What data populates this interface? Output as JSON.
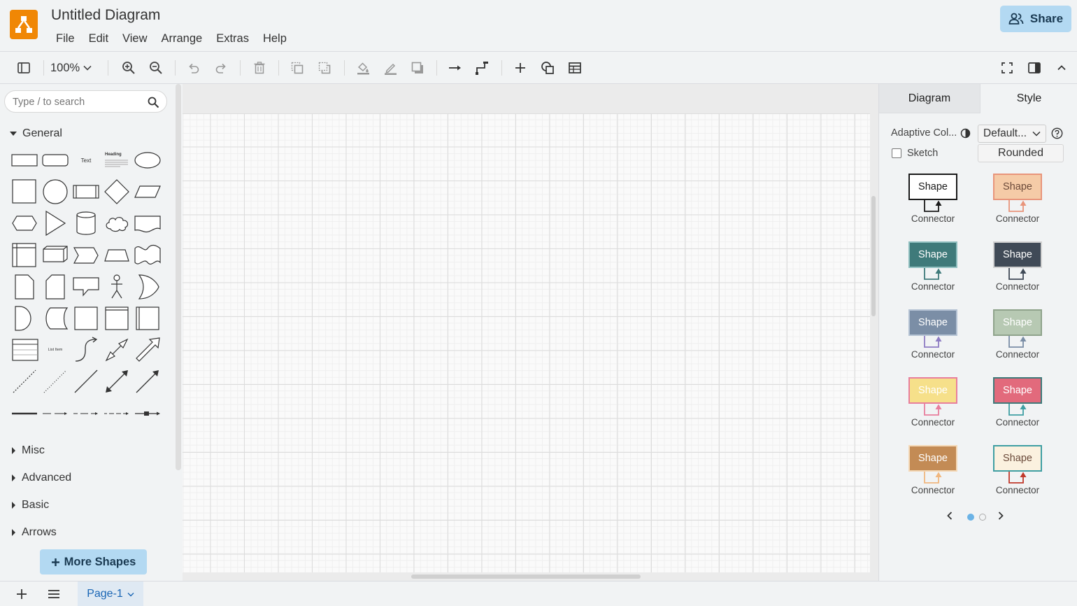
{
  "app": {
    "title": "Untitled Diagram",
    "menu": [
      "File",
      "Edit",
      "View",
      "Arrange",
      "Extras",
      "Help"
    ],
    "share_label": "Share",
    "accent_color": "#f08705"
  },
  "toolbar": {
    "zoom_level": "100%",
    "buttons": [
      "format-panel-toggle",
      "zoom-in",
      "zoom-out",
      "undo",
      "redo",
      "delete",
      "to-front",
      "to-back",
      "fill-color",
      "line-color",
      "shadow",
      "connection",
      "waypoints",
      "insert",
      "shapes",
      "table",
      "fullscreen",
      "format-panel",
      "collapse"
    ]
  },
  "left_panel": {
    "search_placeholder": "Type / to search",
    "general_label": "General",
    "shape_text_label": "Text",
    "shape_heading_label": "Heading",
    "shape_list_item_label": "List Item",
    "sections": [
      "Misc",
      "Advanced",
      "Basic",
      "Arrows"
    ],
    "more_shapes_label": "More Shapes"
  },
  "right_panel": {
    "tabs": [
      "Diagram",
      "Style"
    ],
    "active_tab": "Style",
    "adaptive_colors_label": "Adaptive Col...",
    "adaptive_colors_value": "Default...",
    "sketch_label": "Sketch",
    "sketch_checked": false,
    "rounded_label": "Rounded",
    "styles": [
      {
        "shape": "Shape",
        "connector": "Connector",
        "fill": "#ffffff",
        "stroke": "#1a1a1a",
        "text": "#1a1a1a",
        "line": "#1a1a1a"
      },
      {
        "shape": "Shape",
        "connector": "Connector",
        "fill": "#f5cba7",
        "stroke": "#e8957b",
        "text": "#6b4a3a",
        "line": "#e8957b"
      },
      {
        "shape": "Shape",
        "connector": "Connector",
        "fill": "#3f7a7a",
        "stroke": "#8fbfbf",
        "text": "#ffffff",
        "line": "#3f7a7a"
      },
      {
        "shape": "Shape",
        "connector": "Connector",
        "fill": "#404a57",
        "stroke": "#cfcfcf",
        "text": "#ffffff",
        "line": "#404a57"
      },
      {
        "shape": "Shape",
        "connector": "Connector",
        "fill": "#7b8ea6",
        "stroke": "#b5c3d4",
        "text": "#ffffff",
        "line": "#8e7cc3"
      },
      {
        "shape": "Shape",
        "connector": "Connector",
        "fill": "#b7c9b3",
        "stroke": "#8fa38b",
        "text": "#ffffff",
        "line": "#7b8ea6"
      },
      {
        "shape": "Shape",
        "connector": "Connector",
        "fill": "#f6e08a",
        "stroke": "#e87e9d",
        "text": "#ffffff",
        "line": "#e87e9d"
      },
      {
        "shape": "Shape",
        "connector": "Connector",
        "fill": "#e26a7c",
        "stroke": "#3f7a7a",
        "text": "#ffffff",
        "line": "#3f9fa3"
      },
      {
        "shape": "Shape",
        "connector": "Connector",
        "fill": "#c38b55",
        "stroke": "#f4d9b8",
        "text": "#ffffff",
        "line": "#f0b77f"
      },
      {
        "shape": "Shape",
        "connector": "Connector",
        "fill": "#fbf1df",
        "stroke": "#3f9fa3",
        "text": "#6b4a3a",
        "line": "#c0392b"
      }
    ],
    "carousel_page": 1,
    "carousel_pages": 2
  },
  "footer": {
    "page_tab": "Page-1"
  }
}
